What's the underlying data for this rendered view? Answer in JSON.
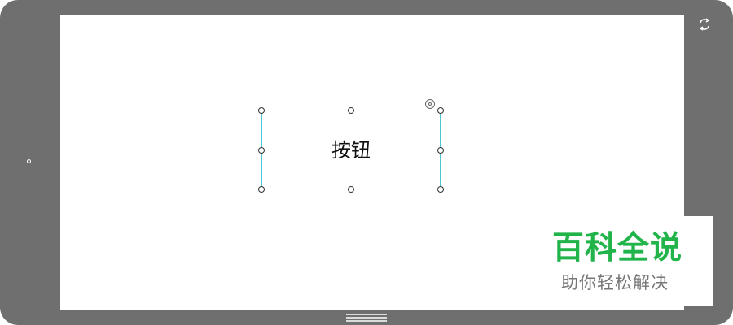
{
  "canvas": {
    "button": {
      "label": "按钮"
    }
  },
  "watermark": {
    "title": "百科全说",
    "subtitle": "助你轻松解决"
  },
  "icons": {
    "rotate": "rotate-icon",
    "home": "home-lines-icon",
    "side_indicator": "side-dot-icon"
  },
  "colors": {
    "device": "#6f6f6f",
    "selection_border": "#4ac7d6",
    "watermark_green": "#21b44a",
    "watermark_gray": "#777777"
  }
}
